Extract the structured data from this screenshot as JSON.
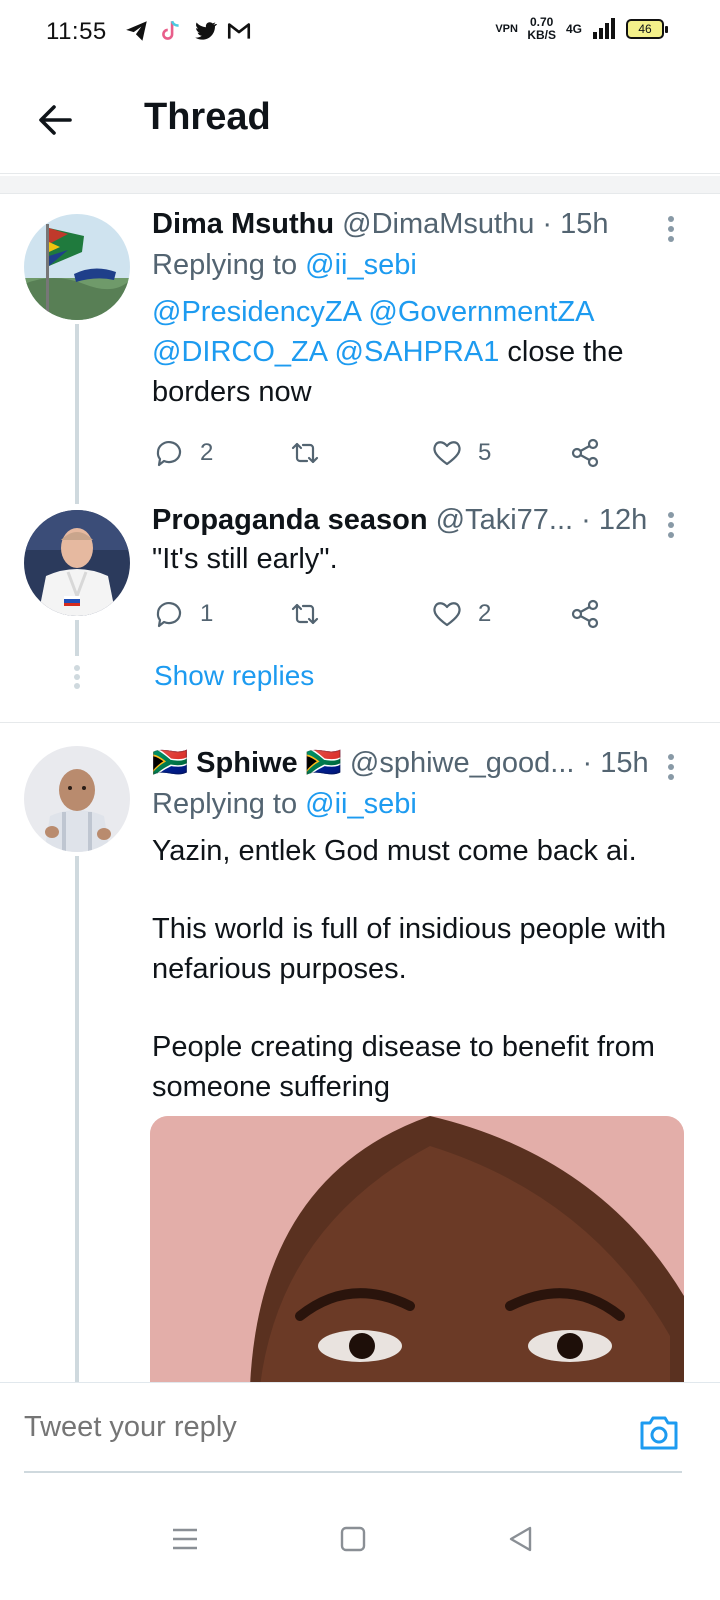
{
  "status": {
    "time": "11:55",
    "vpn": "VPN",
    "speed_value": "0.70",
    "speed_unit": "KB/S",
    "network": "4G",
    "battery": "46"
  },
  "header": {
    "title": "Thread"
  },
  "tweets": [
    {
      "name": "Dima Msuthu",
      "handle": "@DimaMsuthu",
      "time": "· 15h",
      "replying_label": "Replying to",
      "replying_to": "@ii_sebi",
      "mentions": "@PresidencyZA @GovernmentZA @DIRCO_ZA @SAHPRA1",
      "text": " close the borders now",
      "replies": "2",
      "retweets": "",
      "likes": "5"
    },
    {
      "name": "Propaganda season",
      "handle": "@Taki77...",
      "time": "· 12h",
      "text": "\"It's still early\".",
      "replies": "1",
      "retweets": "",
      "likes": "2"
    },
    {
      "flag_left": "🇿🇦",
      "name": "Sphiwe",
      "flag_right": "🇿🇦",
      "handle": "@sphiwe_good...",
      "time": "· 15h",
      "replying_label": "Replying to",
      "replying_to": "@ii_sebi",
      "para1": "Yazin, entlek God must come back ai.",
      "para2": "This world is full of insidious people with nefarious purposes.",
      "para3": "People creating disease to benefit from someone suffering"
    }
  ],
  "show_replies": "Show replies",
  "compose": {
    "placeholder": "Tweet your reply"
  },
  "colors": {
    "accent": "#1d9bf0",
    "muted": "#536471",
    "text": "#0f1419"
  }
}
